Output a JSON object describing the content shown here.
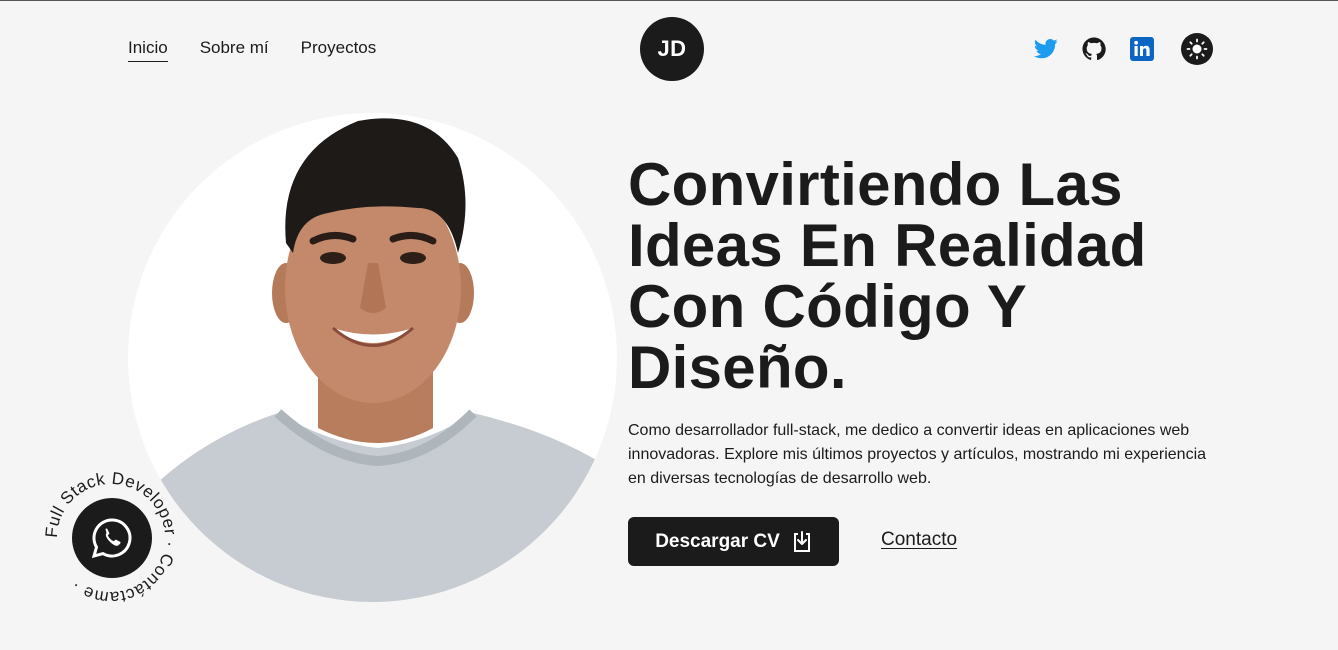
{
  "nav": {
    "links": [
      {
        "label": "Inicio",
        "active": true
      },
      {
        "label": "Sobre mí",
        "active": false
      },
      {
        "label": "Proyectos",
        "active": false
      }
    ],
    "logo_text": "JD",
    "socials": [
      {
        "icon": "twitter-icon",
        "color": "#1d9bf0"
      },
      {
        "icon": "github-icon",
        "color": "#1b1b1b"
      },
      {
        "icon": "linkedin-icon",
        "color": "#0a66c2"
      }
    ],
    "theme_icon": "sun-icon"
  },
  "hero": {
    "headline": [
      "Convirtiendo Las",
      "Ideas En Realidad",
      "Con Código Y",
      "Diseño."
    ],
    "intro": "Como desarrollador full-stack, me dedico a convertir ideas en aplicaciones web innovadoras. Explore mis últimos proyectos y artículos, mostrando mi experiencia en diversas tecnologías de desarrollo web.",
    "cta_label": "Descargar CV",
    "contact_label": "Contacto",
    "badge_text": "Full Stack Developer · Contáctame ·",
    "badge_icon": "whatsapp-icon"
  },
  "colors": {
    "background": "#f5f5f5",
    "dark": "#1b1b1b",
    "shirt": "#c9ced3"
  }
}
